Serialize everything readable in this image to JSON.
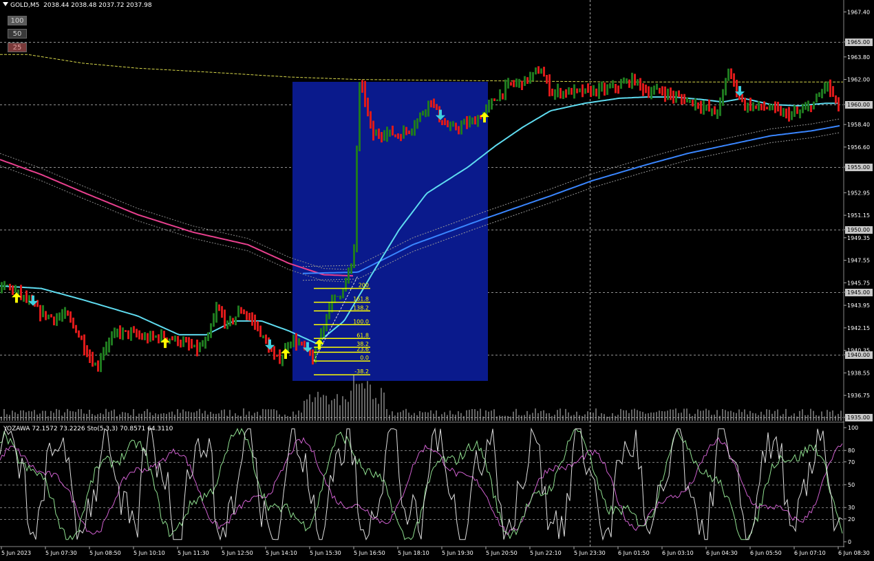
{
  "header": {
    "symbol_timeframe": "GOLD,M5",
    "ohlc": "2038.44 2038.48 2037.72 2037.98"
  },
  "level_buttons": [
    "100",
    "50",
    "25"
  ],
  "indicator_header": "YOZAWA 72.1572 73.2226  Sto(5,3,3) 70.8571 64.3110",
  "colors": {
    "background": "#000000",
    "bull_bar": "#1f7a1f",
    "bear_bar": "#dd1a1a",
    "ma_fast": "#5fdcf0",
    "ma_mid": "#3a86ff",
    "ma_slow": "#e8408e",
    "fib_box": "#0a1a8c",
    "fib_lines": "#ffff00",
    "arrow_up": "#ffff00",
    "arrow_down": "#3fd0e0",
    "stoch_main": "#90e090",
    "stoch_signal": "#d060d0",
    "yozawa": "#e0e0e0",
    "grid": "#d0d0d0"
  },
  "price_axis": {
    "labels": [
      "1967.40",
      "1965.00",
      "1963.80",
      "1962.00",
      "1960.00",
      "1958.40",
      "1956.60",
      "1955.00",
      "1952.95",
      "1951.15",
      "1950.00",
      "1949.35",
      "1947.55",
      "1945.75",
      "1945.00",
      "1943.95",
      "1942.15",
      "1940.35",
      "1940.00",
      "1938.55",
      "1936.75",
      "1935.00"
    ],
    "highlighted": [
      "1965.00",
      "1960.00",
      "1955.00",
      "1950.00",
      "1945.00",
      "1940.00",
      "1935.00"
    ]
  },
  "indicator_axis": {
    "labels": [
      "100",
      "80",
      "70",
      "50",
      "30",
      "20",
      "0"
    ]
  },
  "time_axis": {
    "labels": [
      "5 Jun 2023",
      "5 Jun 07:30",
      "5 Jun 08:50",
      "5 Jun 10:10",
      "5 Jun 11:30",
      "5 Jun 12:50",
      "5 Jun 14:10",
      "5 Jun 15:30",
      "5 Jun 16:50",
      "5 Jun 18:10",
      "5 Jun 19:30",
      "5 Jun 20:50",
      "5 Jun 22:10",
      "5 Jun 23:30",
      "6 Jun 01:50",
      "6 Jun 03:10",
      "6 Jun 04:30",
      "6 Jun 05:50",
      "6 Jun 07:10",
      "6 Jun 08:30"
    ]
  },
  "fibonacci": {
    "levels": [
      {
        "label": "200",
        "price": 1945.3
      },
      {
        "label": "161.8",
        "price": 1944.2
      },
      {
        "label": "138.2",
        "price": 1943.5
      },
      {
        "label": "100.0",
        "price": 1942.4
      },
      {
        "label": "61.8",
        "price": 1941.3
      },
      {
        "label": "38.2",
        "price": 1940.6
      },
      {
        "label": "23.6",
        "price": 1940.2
      },
      {
        "label": "0.0",
        "price": 1939.5
      },
      {
        "label": "-38.2",
        "price": 1938.4
      }
    ]
  },
  "chart_data": {
    "type": "candlestick",
    "symbol": "GOLD",
    "timeframe": "M5",
    "ylim": [
      1935.0,
      1968.0
    ],
    "series": [
      {
        "name": "bars",
        "type": "bar",
        "values": "generated from anchors"
      },
      {
        "name": "ma_fast",
        "type": "line"
      },
      {
        "name": "ma_mid",
        "type": "line"
      },
      {
        "name": "ma_slow",
        "type": "line"
      }
    ],
    "price_anchors": [
      [
        0,
        1945.2
      ],
      [
        10,
        1945.5
      ],
      [
        25,
        1945.0
      ],
      [
        45,
        1944.0
      ],
      [
        60,
        1943.3
      ],
      [
        80,
        1942.9
      ],
      [
        95,
        1943.2
      ],
      [
        110,
        1942.0
      ],
      [
        130,
        1939.8
      ],
      [
        140,
        1938.9
      ],
      [
        150,
        1940.5
      ],
      [
        170,
        1941.8
      ],
      [
        190,
        1941.7
      ],
      [
        210,
        1941.3
      ],
      [
        235,
        1941.5
      ],
      [
        260,
        1941.1
      ],
      [
        285,
        1940.4
      ],
      [
        300,
        1941.0
      ],
      [
        315,
        1943.8
      ],
      [
        330,
        1942.3
      ],
      [
        350,
        1943.6
      ],
      [
        370,
        1942.5
      ],
      [
        385,
        1941.0
      ],
      [
        400,
        1939.6
      ],
      [
        410,
        1939.9
      ],
      [
        420,
        1941.2
      ],
      [
        432,
        1941.0
      ],
      [
        445,
        1940.3
      ],
      [
        455,
        1939.5
      ],
      [
        465,
        1941.5
      ],
      [
        478,
        1944.0
      ],
      [
        495,
        1945.0
      ],
      [
        510,
        1947.0
      ],
      [
        515,
        1949.0
      ],
      [
        520,
        1961.5
      ],
      [
        528,
        1961.0
      ],
      [
        540,
        1957.5
      ],
      [
        560,
        1957.8
      ],
      [
        580,
        1957.5
      ],
      [
        600,
        1958.3
      ],
      [
        615,
        1959.5
      ],
      [
        625,
        1960.5
      ],
      [
        640,
        1958.7
      ],
      [
        655,
        1958.0
      ],
      [
        670,
        1958.3
      ],
      [
        690,
        1958.7
      ],
      [
        705,
        1959.5
      ],
      [
        720,
        1960.5
      ],
      [
        740,
        1961.6
      ],
      [
        760,
        1961.8
      ],
      [
        775,
        1962.4
      ],
      [
        785,
        1962.8
      ],
      [
        800,
        1961.0
      ],
      [
        820,
        1961.0
      ],
      [
        850,
        1961.0
      ],
      [
        880,
        1961.2
      ],
      [
        900,
        1961.5
      ],
      [
        920,
        1962.0
      ],
      [
        940,
        1961.0
      ],
      [
        960,
        1961.1
      ],
      [
        980,
        1960.6
      ],
      [
        1000,
        1960.3
      ],
      [
        1020,
        1959.9
      ],
      [
        1040,
        1959.2
      ],
      [
        1050,
        1960.8
      ],
      [
        1058,
        1962.8
      ],
      [
        1065,
        1961.8
      ],
      [
        1080,
        1960.0
      ],
      [
        1100,
        1959.8
      ],
      [
        1120,
        1959.7
      ],
      [
        1140,
        1959.2
      ],
      [
        1160,
        1959.3
      ],
      [
        1175,
        1959.8
      ],
      [
        1190,
        1960.6
      ],
      [
        1200,
        1961.8
      ],
      [
        1210,
        1960.6
      ],
      [
        1220,
        1959.6
      ]
    ],
    "ma_fast": [
      [
        0,
        1945.5
      ],
      [
        60,
        1945.3
      ],
      [
        120,
        1944.4
      ],
      [
        200,
        1943.1
      ],
      [
        260,
        1941.6
      ],
      [
        300,
        1941.6
      ],
      [
        340,
        1942.7
      ],
      [
        380,
        1942.7
      ],
      [
        420,
        1941.9
      ],
      [
        460,
        1940.9
      ],
      [
        500,
        1942.7
      ],
      [
        540,
        1946.4
      ],
      [
        580,
        1950.0
      ],
      [
        620,
        1952.9
      ],
      [
        680,
        1955.0
      ],
      [
        720,
        1956.7
      ],
      [
        760,
        1958.2
      ],
      [
        800,
        1959.5
      ],
      [
        850,
        1960.1
      ],
      [
        900,
        1960.5
      ],
      [
        940,
        1960.6
      ],
      [
        980,
        1960.6
      ],
      [
        1020,
        1960.4
      ],
      [
        1050,
        1960.2
      ],
      [
        1080,
        1960.5
      ],
      [
        1120,
        1960.0
      ],
      [
        1160,
        1959.9
      ],
      [
        1200,
        1960.1
      ],
      [
        1220,
        1960.1
      ]
    ],
    "ma_mid": [
      [
        440,
        1946.5
      ],
      [
        520,
        1946.6
      ],
      [
        600,
        1948.8
      ],
      [
        700,
        1950.8
      ],
      [
        800,
        1952.7
      ],
      [
        860,
        1953.9
      ],
      [
        940,
        1955.2
      ],
      [
        1000,
        1956.1
      ],
      [
        1060,
        1956.8
      ],
      [
        1120,
        1957.5
      ],
      [
        1180,
        1957.9
      ],
      [
        1220,
        1958.3
      ]
    ],
    "ma_slow": [
      [
        0,
        1955.6
      ],
      [
        60,
        1954.4
      ],
      [
        120,
        1953.0
      ],
      [
        200,
        1951.2
      ],
      [
        280,
        1949.8
      ],
      [
        360,
        1948.8
      ],
      [
        420,
        1947.3
      ],
      [
        470,
        1946.4
      ],
      [
        515,
        1946.3
      ]
    ],
    "arrows": [
      {
        "x": 24,
        "dir": "up"
      },
      {
        "x": 48,
        "dir": "down"
      },
      {
        "x": 240,
        "dir": "up"
      },
      {
        "x": 392,
        "dir": "down"
      },
      {
        "x": 415,
        "dir": "up"
      },
      {
        "x": 447,
        "dir": "down"
      },
      {
        "x": 464,
        "dir": "up"
      },
      {
        "x": 640,
        "dir": "down"
      },
      {
        "x": 704,
        "dir": "up"
      },
      {
        "x": 1075,
        "dir": "down"
      }
    ]
  }
}
